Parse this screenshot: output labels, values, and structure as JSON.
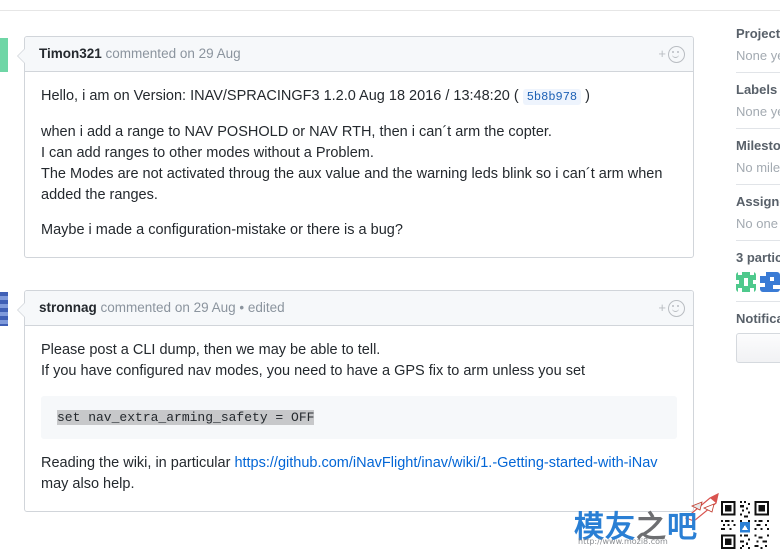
{
  "comments": [
    {
      "author": "Timon321",
      "meta": "commented on 29 Aug",
      "react_plus": "+",
      "paragraphs": [
        {
          "type": "text_with_code",
          "before": "Hello, i am on Version: INAV/SPRACINGF3 1.2.0 Aug 18 2016 / 13:48:20 (",
          "code": "5b8b978",
          "after": ")"
        },
        {
          "type": "lines",
          "lines": [
            "when i add a range to NAV POSHOLD or NAV RTH, then i can´t arm the copter.",
            "I can add ranges to other modes without a Problem.",
            "The Modes are not activated throug the aux value and the warning leds blink so i can´t arm when added the ranges."
          ]
        },
        {
          "type": "lines",
          "lines": [
            "Maybe i made a configuration-mistake or there is a bug?"
          ]
        }
      ]
    },
    {
      "author": "stronnag",
      "meta": "commented on 29 Aug • edited",
      "react_plus": "+",
      "paragraphs": [
        {
          "type": "lines",
          "lines": [
            "Please post a CLI dump, then we may be able to tell.",
            "If you have configured nav modes, you need to have a GPS fix to arm unless you set"
          ]
        },
        {
          "type": "code_block",
          "code": "set nav_extra_arming_safety = OFF"
        },
        {
          "type": "text_with_link",
          "before": "Reading the wiki, in particular ",
          "link": "https://github.com/iNavFlight/inav/wiki/1.-Getting-started-with-iNav",
          "after": " may also help."
        }
      ]
    }
  ],
  "sidebar": {
    "projects": {
      "title": "Projects",
      "value": "None ye"
    },
    "labels": {
      "title": "Labels",
      "value": "None ye"
    },
    "milestone": {
      "title": "Milesto",
      "value": "No mile"
    },
    "assignees": {
      "title": "Assigne",
      "value": "No one"
    },
    "participants": {
      "title": "3 partic"
    },
    "notifications": {
      "title": "Notifica"
    }
  },
  "watermark": {
    "text_blue_1": "模友",
    "text_grey": "之",
    "text_blue_2": "吧",
    "url": "http://www.mozi8.com"
  },
  "colors": {
    "link": "#0366d6",
    "sha_bg": "#eef4fd",
    "header_bg": "#f6f8fa",
    "border": "#d1d5da",
    "avatar_green": "#4ec98c",
    "avatar_blue": "#3a7bd5"
  }
}
